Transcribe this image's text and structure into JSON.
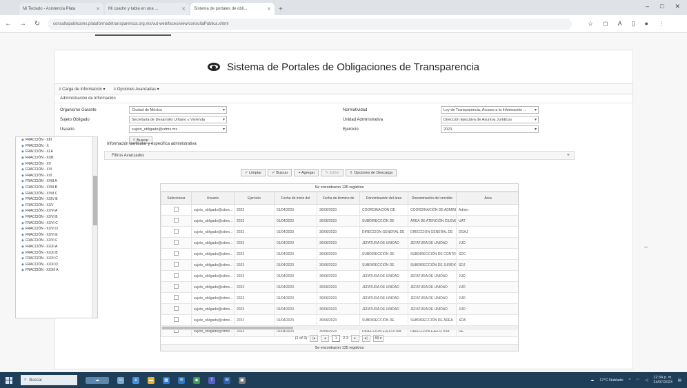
{
  "browser": {
    "tabs": [
      {
        "title": "Mi Teclado - Asistencia Plata",
        "active": false
      },
      {
        "title": "Mi cuadro y tabla en una ...",
        "active": false
      },
      {
        "title": "Sistema de portales de obli...",
        "active": true
      }
    ],
    "new_tab": "+",
    "url": "consultapublicamx.plataformadetransparencia.org.mx/vut-web/faces/view/consultaPublica.xhtml",
    "window_controls": [
      "–",
      "□",
      "✕"
    ]
  },
  "page": {
    "title": "Sistema de Portales de Obligaciones de Transparencia",
    "menu": [
      "≡ Carga de Información ▾",
      "≡ Opciones Avanzadas ▾"
    ],
    "section_title": "Administración de Información",
    "form": {
      "sujeto_label": "Organismo Garante",
      "sujeto_value": "Ciudad de México",
      "sujeto_obligado_label": "Sujeto Obligado",
      "sujeto_obligado_value": "Secretaría de Desarrollo Urbano y Vivienda",
      "usuario_label": "Usuario",
      "usuario_value": "sujeto_obligado@cdmx.mx",
      "normatividad_label": "Normatividad",
      "normatividad_value": "Ley de Transparencia, Acceso a la Información ...",
      "unidad_label": "Unidad Administrativa",
      "unidad_value": "Dirección Ejecutiva de Asuntos Jurídicos",
      "ejercicio_label": "Ejercicio",
      "ejercicio_value": "2023",
      "buscar_label": "Buscar"
    },
    "tree_items": [
      "FRACCIÓN - XIII",
      "FRACCIÓN - X",
      "FRACCIÓN - XLA",
      "FRACCIÓN - XXB",
      "FRACCIÓN - XV",
      "FRACCIÓN - XVI",
      "FRACCIÓN - XVI",
      "FRACCIÓN - XVIII A",
      "FRACCIÓN - XVIII B",
      "FRACCIÓN - XVIII C",
      "FRACCIÓN - XXIV B",
      "FRACCIÓN - XXV",
      "FRACCIÓN - XXVI A",
      "FRACCIÓN - XXVI B",
      "FRACCIÓN - XXVI C",
      "FRACCIÓN - XXVI D",
      "FRACCIÓN - XXVI E",
      "FRACCIÓN - XXVI F",
      "FRACCIÓN - XXXI A",
      "FRACCIÓN - XXXI B",
      "FRACCIÓN - XXXI C",
      "FRACCIÓN - XXXI D",
      "FRACCIÓN - XXXII A"
    ],
    "panel_label": "Información particular y específica administrativa",
    "collapse_label": "Filtros Avanzados",
    "action_buttons": [
      "✓ Limpiar",
      "✓ Buscar",
      "+ Agregar",
      "✎ Editar",
      "⇩ Opciones de Descarga"
    ],
    "grid": {
      "caption": "Se encontraron 135 registros",
      "columns": [
        "Seleccionar",
        "Usuario",
        "Ejercicio",
        "Fecha de inicio del",
        "Fecha de término de",
        "Denominación del área",
        "Denominación del servidor",
        "Área"
      ],
      "rows": [
        [
          "sujeto_obligado@cdmx...",
          "2023",
          "01/04/2023",
          "30/06/2023",
          "COORDINACIÓN DE",
          "COORDINACIÓN DE ADMINISTRACIÓN",
          "Admin"
        ],
        [
          "sujeto_obligado@cdmx...",
          "2023",
          "01/04/2023",
          "30/06/2023",
          "SUBDIRECCIÓN DE",
          "ÁREA DE ATENCIÓN CIUDADANA",
          "UAT"
        ],
        [
          "sujeto_obligado@cdmx...",
          "2023",
          "01/04/2023",
          "30/06/2023",
          "DIRECCIÓN GENERAL DE",
          "DIRECCIÓN GENERAL DE",
          "DGAJ"
        ],
        [
          "sujeto_obligado@cdmx...",
          "2023",
          "01/04/2023",
          "30/06/2023",
          "JEFATURA DE UNIDAD",
          "JEFATURA DE UNIDAD",
          "JUD"
        ],
        [
          "sujeto_obligado@cdmx...",
          "2023",
          "01/04/2023",
          "30/06/2023",
          "SUBDIRECCIÓN DE",
          "SUBDIRECCIÓN DE CONTROL",
          "SDC"
        ],
        [
          "sujeto_obligado@cdmx...",
          "2023",
          "01/04/2023",
          "30/06/2023",
          "SUBDIRECCIÓN DE",
          "SUBDIRECCIÓN DE JURÍDICO",
          "SDJ"
        ],
        [
          "sujeto_obligado@cdmx...",
          "2023",
          "01/04/2023",
          "30/06/2023",
          "JEFATURA DE UNIDAD",
          "JEFATURA DE UNIDAD",
          "JUD"
        ],
        [
          "sujeto_obligado@cdmx...",
          "2023",
          "01/04/2023",
          "30/06/2023",
          "JEFATURA DE UNIDAD",
          "JEFATURA DE UNIDAD",
          "JUD"
        ],
        [
          "sujeto_obligado@cdmx...",
          "2023",
          "01/04/2023",
          "30/06/2023",
          "JEFATURA DE UNIDAD",
          "JEFATURA DE UNIDAD",
          "JUD"
        ],
        [
          "sujeto_obligado@cdmx...",
          "2023",
          "01/04/2023",
          "30/06/2023",
          "JEFATURA DE UNIDAD",
          "JEFATURA DE UNIDAD",
          "JUD"
        ],
        [
          "sujeto_obligado@cdmx...",
          "2023",
          "01/04/2023",
          "30/06/2023",
          "SUBDIRECCIÓN DE",
          "SUBDIRECCIÓN DE ÁREA",
          "SDA"
        ],
        [
          "sujeto_obligado@cdmx...",
          "2023",
          "01/04/2023",
          "30/06/2023",
          "DIRECCIÓN EJECUTIVA",
          "DIRECCIÓN EJECUTIVA",
          "DE"
        ]
      ]
    },
    "pager": {
      "summary": "(1 of 3)",
      "first": "|◂",
      "prev": "◂",
      "page": "1",
      "pages_after": "2 3",
      "next": "▸",
      "last": "▸|",
      "per_page": "50 ▾"
    },
    "grid_footer": "Se encontraron 135 registros"
  },
  "taskbar": {
    "search_placeholder": "Buscar",
    "weather": "17°C Nublado",
    "time": "12:34 p. m.",
    "date": "24/07/2023"
  }
}
